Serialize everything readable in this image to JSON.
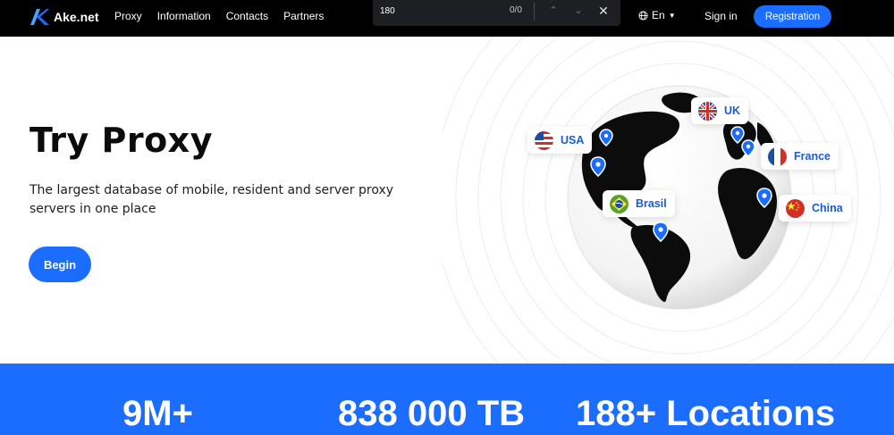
{
  "header": {
    "logo_text": "Ake.net",
    "nav": [
      {
        "label": "Proxy"
      },
      {
        "label": "Information"
      },
      {
        "label": "Contacts"
      },
      {
        "label": "Partners"
      }
    ],
    "language": "En",
    "signin_label": "Sign in",
    "register_label": "Registration"
  },
  "findbar": {
    "query": "180",
    "count": "0/0"
  },
  "hero": {
    "title": "Try Proxy",
    "subtitle": "The largest database of mobile, resident and server proxy servers in one place",
    "cta_label": "Begin"
  },
  "locations": [
    {
      "label": "USA",
      "flag": "us-flag"
    },
    {
      "label": "UK",
      "flag": "uk-flag"
    },
    {
      "label": "France",
      "flag": "france-flag"
    },
    {
      "label": "Brasil",
      "flag": "brasil-flag"
    },
    {
      "label": "China",
      "flag": "china-flag"
    }
  ],
  "stats": [
    {
      "value": "9M+"
    },
    {
      "value": "838 000 TB"
    },
    {
      "value": "188+ Locations"
    }
  ],
  "colors": {
    "accent": "#1a6dff",
    "header_bg": "#000000",
    "tag_text": "#1a5bd6"
  }
}
